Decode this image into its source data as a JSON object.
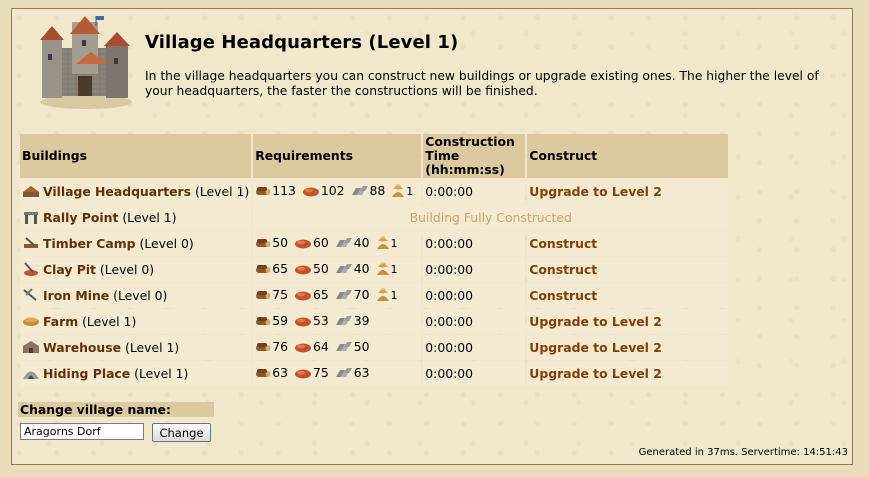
{
  "header": {
    "title": "Village Headquarters (Level 1)",
    "description": "In the village headquarters you can construct new buildings or upgrade existing ones. The higher the level of your headquarters, the faster the constructions will be finished."
  },
  "table": {
    "headers": {
      "buildings": "Buildings",
      "requirements": "Requirements",
      "time_line1": "Construction",
      "time_line2": "Time",
      "time_line3": "(hh:mm:ss)",
      "construct": "Construct"
    },
    "rows": [
      {
        "name": "Village Headquarters",
        "level": "(Level 1)",
        "icon": "headquarters-icon",
        "wood": "113",
        "clay": "102",
        "iron": "88",
        "pop": "1",
        "time": "0:00:00",
        "action": "Upgrade to Level 2"
      },
      {
        "name": "Rally Point",
        "level": "(Level 1)",
        "icon": "rally-point-icon",
        "status": "Building Fully Constructed"
      },
      {
        "name": "Timber Camp",
        "level": "(Level 0)",
        "icon": "timber-camp-icon",
        "wood": "50",
        "clay": "60",
        "iron": "40",
        "pop": "1",
        "time": "0:00:00",
        "action": "Construct"
      },
      {
        "name": "Clay Pit",
        "level": "(Level 0)",
        "icon": "clay-pit-icon",
        "wood": "65",
        "clay": "50",
        "iron": "40",
        "pop": "1",
        "time": "0:00:00",
        "action": "Construct"
      },
      {
        "name": "Iron Mine",
        "level": "(Level 0)",
        "icon": "iron-mine-icon",
        "wood": "75",
        "clay": "65",
        "iron": "70",
        "pop": "1",
        "time": "0:00:00",
        "action": "Construct"
      },
      {
        "name": "Farm",
        "level": "(Level 1)",
        "icon": "farm-icon",
        "wood": "59",
        "clay": "53",
        "iron": "39",
        "pop": "",
        "time": "0:00:00",
        "action": "Upgrade to Level 2"
      },
      {
        "name": "Warehouse",
        "level": "(Level 1)",
        "icon": "warehouse-icon",
        "wood": "76",
        "clay": "64",
        "iron": "50",
        "pop": "",
        "time": "0:00:00",
        "action": "Upgrade to Level 2"
      },
      {
        "name": "Hiding Place",
        "level": "(Level 1)",
        "icon": "hiding-place-icon",
        "wood": "63",
        "clay": "75",
        "iron": "63",
        "pop": "",
        "time": "0:00:00",
        "action": "Upgrade to Level 2"
      }
    ]
  },
  "rename": {
    "label": "Change village name:",
    "value": "Aragorns Dorf",
    "button": "Change"
  },
  "footer": {
    "text": "Generated in 37ms. Servertime: 14:51:43"
  }
}
